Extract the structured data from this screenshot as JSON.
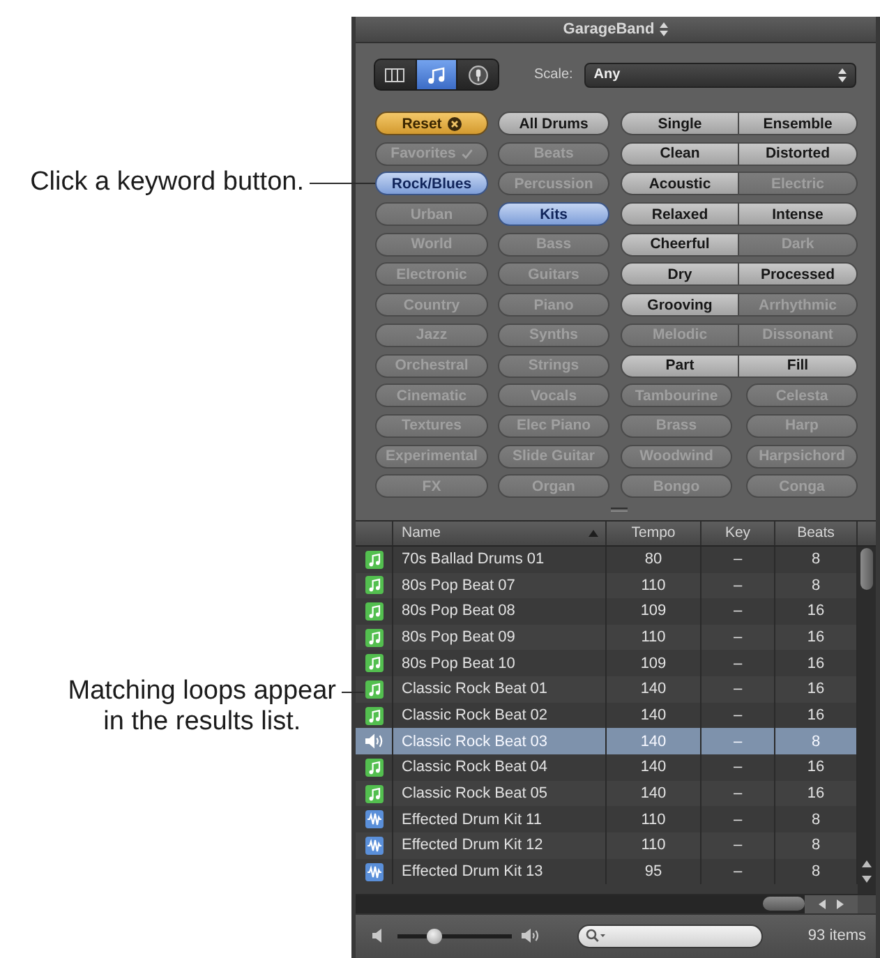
{
  "callouts": [
    {
      "text": "Click a keyword button."
    },
    {
      "text": "Matching loops appear\nin the results list."
    }
  ],
  "window": {
    "title": "GarageBand"
  },
  "view_buttons": [
    {
      "kind": "columns",
      "selected": false
    },
    {
      "kind": "music",
      "selected": true
    },
    {
      "kind": "podcast",
      "selected": false
    }
  ],
  "scale": {
    "label": "Scale:",
    "value": "Any"
  },
  "keyword_rows": [
    {
      "kind": "paired",
      "buttons": [
        {
          "kind": "reset",
          "label": "Reset",
          "selected": false,
          "disabled": false
        },
        {
          "kind": "keyword",
          "label": "All Drums",
          "selected": false,
          "disabled": false
        },
        {
          "kind": "keyword",
          "label": "Single",
          "selected": false,
          "disabled": false
        },
        {
          "kind": "keyword",
          "label": "Ensemble",
          "selected": false,
          "disabled": false
        }
      ]
    },
    {
      "kind": "paired",
      "buttons": [
        {
          "kind": "favorites",
          "label": "Favorites",
          "selected": false,
          "disabled": true
        },
        {
          "kind": "keyword",
          "label": "Beats",
          "selected": false,
          "disabled": true
        },
        {
          "kind": "keyword",
          "label": "Clean",
          "selected": false,
          "disabled": false
        },
        {
          "kind": "keyword",
          "label": "Distorted",
          "selected": false,
          "disabled": false
        }
      ]
    },
    {
      "kind": "paired",
      "buttons": [
        {
          "kind": "keyword",
          "label": "Rock/Blues",
          "selected": true,
          "disabled": false
        },
        {
          "kind": "keyword",
          "label": "Percussion",
          "selected": false,
          "disabled": true
        },
        {
          "kind": "keyword",
          "label": "Acoustic",
          "selected": false,
          "disabled": false
        },
        {
          "kind": "keyword",
          "label": "Electric",
          "selected": false,
          "disabled": true
        }
      ]
    },
    {
      "kind": "paired",
      "buttons": [
        {
          "kind": "keyword",
          "label": "Urban",
          "selected": false,
          "disabled": true
        },
        {
          "kind": "keyword",
          "label": "Kits",
          "selected": true,
          "disabled": false
        },
        {
          "kind": "keyword",
          "label": "Relaxed",
          "selected": false,
          "disabled": false
        },
        {
          "kind": "keyword",
          "label": "Intense",
          "selected": false,
          "disabled": false
        }
      ]
    },
    {
      "kind": "paired",
      "buttons": [
        {
          "kind": "keyword",
          "label": "World",
          "selected": false,
          "disabled": true
        },
        {
          "kind": "keyword",
          "label": "Bass",
          "selected": false,
          "disabled": true
        },
        {
          "kind": "keyword",
          "label": "Cheerful",
          "selected": false,
          "disabled": false
        },
        {
          "kind": "keyword",
          "label": "Dark",
          "selected": false,
          "disabled": true
        }
      ]
    },
    {
      "kind": "paired",
      "buttons": [
        {
          "kind": "keyword",
          "label": "Electronic",
          "selected": false,
          "disabled": true
        },
        {
          "kind": "keyword",
          "label": "Guitars",
          "selected": false,
          "disabled": true
        },
        {
          "kind": "keyword",
          "label": "Dry",
          "selected": false,
          "disabled": false
        },
        {
          "kind": "keyword",
          "label": "Processed",
          "selected": false,
          "disabled": false
        }
      ]
    },
    {
      "kind": "paired",
      "buttons": [
        {
          "kind": "keyword",
          "label": "Country",
          "selected": false,
          "disabled": true
        },
        {
          "kind": "keyword",
          "label": "Piano",
          "selected": false,
          "disabled": true
        },
        {
          "kind": "keyword",
          "label": "Grooving",
          "selected": false,
          "disabled": false
        },
        {
          "kind": "keyword",
          "label": "Arrhythmic",
          "selected": false,
          "disabled": true
        }
      ]
    },
    {
      "kind": "paired",
      "buttons": [
        {
          "kind": "keyword",
          "label": "Jazz",
          "selected": false,
          "disabled": true
        },
        {
          "kind": "keyword",
          "label": "Synths",
          "selected": false,
          "disabled": true
        },
        {
          "kind": "keyword",
          "label": "Melodic",
          "selected": false,
          "disabled": true
        },
        {
          "kind": "keyword",
          "label": "Dissonant",
          "selected": false,
          "disabled": true
        }
      ]
    },
    {
      "kind": "paired",
      "buttons": [
        {
          "kind": "keyword",
          "label": "Orchestral",
          "selected": false,
          "disabled": true
        },
        {
          "kind": "keyword",
          "label": "Strings",
          "selected": false,
          "disabled": true
        },
        {
          "kind": "keyword",
          "label": "Part",
          "selected": false,
          "disabled": false
        },
        {
          "kind": "keyword",
          "label": "Fill",
          "selected": false,
          "disabled": false
        }
      ]
    },
    {
      "kind": "single",
      "buttons": [
        {
          "kind": "keyword",
          "label": "Cinematic",
          "selected": false,
          "disabled": true
        },
        {
          "kind": "keyword",
          "label": "Vocals",
          "selected": false,
          "disabled": true
        },
        {
          "kind": "keyword",
          "label": "Tambourine",
          "selected": false,
          "disabled": true
        },
        {
          "kind": "keyword",
          "label": "Celesta",
          "selected": false,
          "disabled": true
        }
      ]
    },
    {
      "kind": "single",
      "buttons": [
        {
          "kind": "keyword",
          "label": "Textures",
          "selected": false,
          "disabled": true
        },
        {
          "kind": "keyword",
          "label": "Elec Piano",
          "selected": false,
          "disabled": true
        },
        {
          "kind": "keyword",
          "label": "Brass",
          "selected": false,
          "disabled": true
        },
        {
          "kind": "keyword",
          "label": "Harp",
          "selected": false,
          "disabled": true
        }
      ]
    },
    {
      "kind": "single",
      "buttons": [
        {
          "kind": "keyword",
          "label": "Experimental",
          "selected": false,
          "disabled": true
        },
        {
          "kind": "keyword",
          "label": "Slide Guitar",
          "selected": false,
          "disabled": true
        },
        {
          "kind": "keyword",
          "label": "Woodwind",
          "selected": false,
          "disabled": true
        },
        {
          "kind": "keyword",
          "label": "Harpsichord",
          "selected": false,
          "disabled": true
        }
      ]
    },
    {
      "kind": "single",
      "buttons": [
        {
          "kind": "keyword",
          "label": "FX",
          "selected": false,
          "disabled": true
        },
        {
          "kind": "keyword",
          "label": "Organ",
          "selected": false,
          "disabled": true
        },
        {
          "kind": "keyword",
          "label": "Bongo",
          "selected": false,
          "disabled": true
        },
        {
          "kind": "keyword",
          "label": "Conga",
          "selected": false,
          "disabled": true
        }
      ]
    }
  ],
  "results": {
    "columns": [
      {
        "label": "Name",
        "sorted": true
      },
      {
        "label": "Tempo",
        "sorted": false
      },
      {
        "label": "Key",
        "sorted": false
      },
      {
        "label": "Beats",
        "sorted": false
      }
    ],
    "rows": [
      {
        "kind": "software",
        "playing": false,
        "selected": false,
        "name": "70s Ballad Drums 01",
        "tempo": "80",
        "key": "–",
        "beats": "8"
      },
      {
        "kind": "software",
        "playing": false,
        "selected": false,
        "name": "80s Pop Beat 07",
        "tempo": "110",
        "key": "–",
        "beats": "8"
      },
      {
        "kind": "software",
        "playing": false,
        "selected": false,
        "name": "80s Pop Beat 08",
        "tempo": "109",
        "key": "–",
        "beats": "16"
      },
      {
        "kind": "software",
        "playing": false,
        "selected": false,
        "name": "80s Pop Beat 09",
        "tempo": "110",
        "key": "–",
        "beats": "16"
      },
      {
        "kind": "software",
        "playing": false,
        "selected": false,
        "name": "80s Pop Beat 10",
        "tempo": "109",
        "key": "–",
        "beats": "16"
      },
      {
        "kind": "software",
        "playing": false,
        "selected": false,
        "name": "Classic Rock Beat 01",
        "tempo": "140",
        "key": "–",
        "beats": "16"
      },
      {
        "kind": "software",
        "playing": false,
        "selected": false,
        "name": "Classic Rock Beat 02",
        "tempo": "140",
        "key": "–",
        "beats": "16"
      },
      {
        "playing": true,
        "selected": true,
        "name": "Classic Rock Beat 03",
        "tempo": "140",
        "key": "–",
        "beats": "8"
      },
      {
        "kind": "software",
        "playing": false,
        "selected": false,
        "name": "Classic Rock Beat 04",
        "tempo": "140",
        "key": "–",
        "beats": "16"
      },
      {
        "kind": "software",
        "playing": false,
        "selected": false,
        "name": "Classic Rock Beat 05",
        "tempo": "140",
        "key": "–",
        "beats": "16"
      },
      {
        "kind": "audio",
        "playing": false,
        "selected": false,
        "name": "Effected Drum Kit 11",
        "tempo": "110",
        "key": "–",
        "beats": "8"
      },
      {
        "kind": "audio",
        "playing": false,
        "selected": false,
        "name": "Effected Drum Kit 12",
        "tempo": "110",
        "key": "–",
        "beats": "8"
      },
      {
        "kind": "audio",
        "playing": false,
        "selected": false,
        "name": "Effected Drum Kit 13",
        "tempo": "95",
        "key": "–",
        "beats": "8"
      }
    ]
  },
  "footer": {
    "volume": {
      "level": 0.3
    },
    "item_count": "93 items"
  }
}
